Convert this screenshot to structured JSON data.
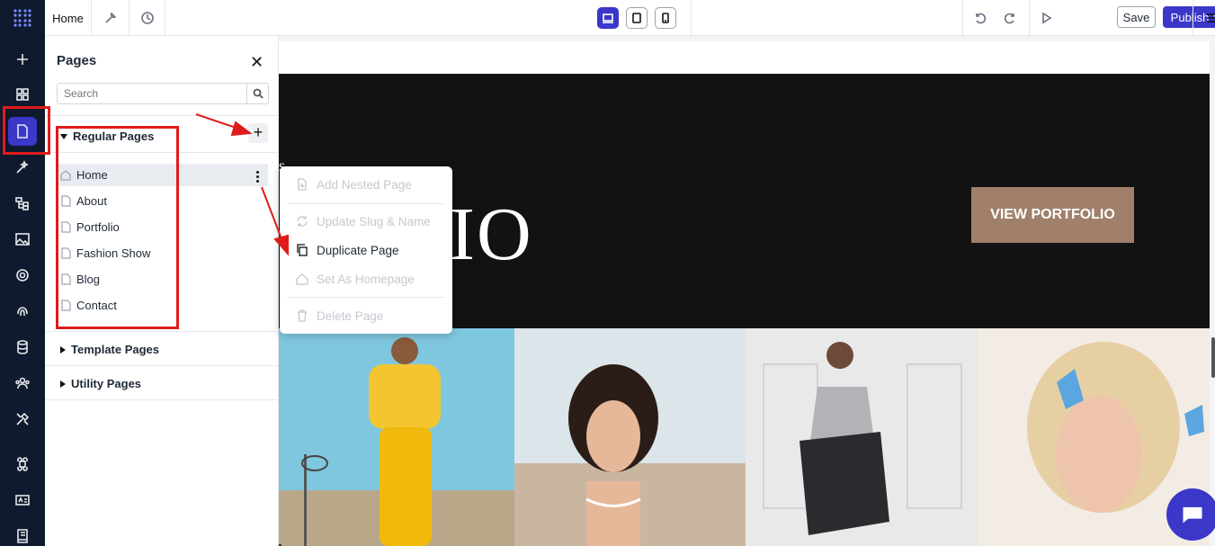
{
  "topbar": {
    "tab_home": "Home",
    "devices": [
      "laptop-icon",
      "tablet-icon",
      "phone-icon"
    ],
    "save_label": "Save",
    "publish_label": "Publish"
  },
  "rail": {
    "icons": [
      "add-icon",
      "widgets-icon",
      "pages-icon",
      "magic-icon",
      "tree-icon",
      "image-icon",
      "settings-icon",
      "fingerprint-icon",
      "database-icon",
      "users-icon",
      "tools-icon",
      "command-icon",
      "id-card-icon",
      "book-icon"
    ]
  },
  "panel": {
    "title": "Pages",
    "search_placeholder": "Search",
    "sections": {
      "regular": "Regular Pages",
      "template": "Template Pages",
      "utility": "Utility Pages"
    },
    "pages": [
      "Home",
      "About",
      "Portfolio",
      "Fashion Show",
      "Blog",
      "Contact"
    ]
  },
  "context_menu": {
    "items": [
      {
        "label": "Add Nested Page",
        "enabled": false
      },
      {
        "label": "Update Slug & Name",
        "enabled": false
      },
      {
        "label": "Duplicate Page",
        "enabled": true
      },
      {
        "label": "Set As Homepage",
        "enabled": false
      },
      {
        "label": "Delete Page",
        "enabled": false
      }
    ]
  },
  "canvas": {
    "hero_text": "IO",
    "hero_fragment": "s",
    "view_button": "VIEW PORTFOLIO"
  },
  "colors": {
    "accent": "#3b37c9",
    "rail_bg": "#0f1a2e",
    "hero_bg": "#121212",
    "portfolio_button": "#a0806b",
    "annotation_red": "#e01b1b"
  }
}
